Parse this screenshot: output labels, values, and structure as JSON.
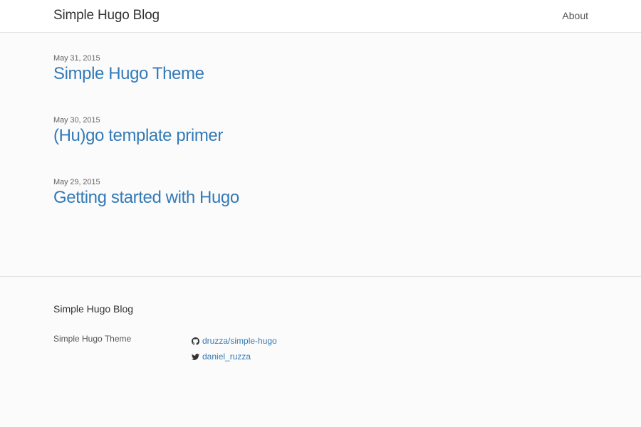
{
  "header": {
    "brand": "Simple Hugo Blog",
    "nav": [
      {
        "label": "About"
      }
    ]
  },
  "posts": [
    {
      "date": "May 31, 2015",
      "title": "Simple Hugo Theme"
    },
    {
      "date": "May 30, 2015",
      "title": "(Hu)go template primer"
    },
    {
      "date": "May 29, 2015",
      "title": "Getting started with Hugo"
    }
  ],
  "footer": {
    "title": "Simple Hugo Blog",
    "description": "Simple Hugo Theme",
    "links": [
      {
        "icon": "github-icon",
        "label": "druzza/simple-hugo"
      },
      {
        "icon": "twitter-icon",
        "label": "daniel_ruzza"
      }
    ]
  },
  "colors": {
    "link": "#337ab7",
    "text": "#333333",
    "background": "#fbfbfb",
    "header_background": "#ffffff",
    "border": "#e3e3e3"
  }
}
